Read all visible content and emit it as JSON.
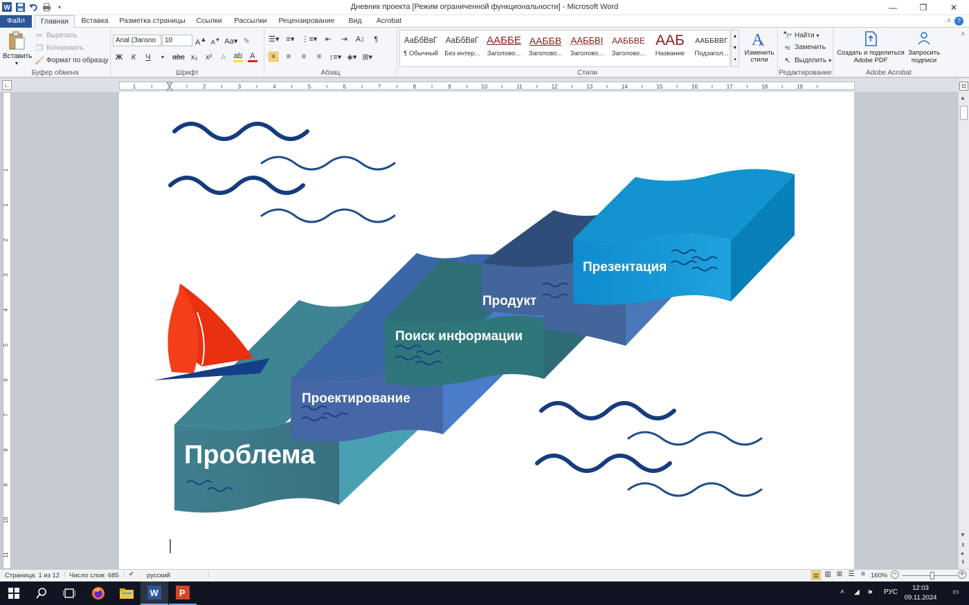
{
  "window": {
    "title": "Дневник проекта [Режим ограниченной функциональности]  -  Microsoft Word",
    "controls": {
      "minimize": "—",
      "restore": "❐",
      "close": "✕"
    }
  },
  "tabs": [
    {
      "label": "Файл"
    },
    {
      "label": "Главная"
    },
    {
      "label": "Вставка"
    },
    {
      "label": "Разметка страницы"
    },
    {
      "label": "Ссылки"
    },
    {
      "label": "Рассылки"
    },
    {
      "label": "Рецензирование"
    },
    {
      "label": "Вид"
    },
    {
      "label": "Acrobat"
    }
  ],
  "ribbon": {
    "clipboard": {
      "paste": "Вставить",
      "cut": "Вырезать",
      "copy": "Копировать",
      "format_painter": "Формат по образцу",
      "label": "Буфер обмена"
    },
    "font": {
      "name": "Arial (Заголо",
      "size": "10",
      "label": "Шрифт"
    },
    "paragraph": {
      "label": "Абзац"
    },
    "styles": {
      "label": "Стили",
      "items": [
        {
          "preview": "АаБбВвГ",
          "name": "¶ Обычный"
        },
        {
          "preview": "АаБбВвГ",
          "name": "Без интер..."
        },
        {
          "preview": "ААББЕ",
          "name": "Заголово..."
        },
        {
          "preview": "ААББВ",
          "name": "Заголово..."
        },
        {
          "preview": "ААББВІ",
          "name": "Заголово..."
        },
        {
          "preview": "ААББВЕ",
          "name": "Заголово..."
        },
        {
          "preview": "ААБ",
          "name": "Название"
        },
        {
          "preview": "ААББВВГ",
          "name": "Подзагол..."
        }
      ],
      "change_styles": "Изменить стили"
    },
    "editing": {
      "find": "Найти",
      "replace": "Заменить",
      "select": "Выделить",
      "label": "Редактирование"
    },
    "acrobat": {
      "create_pdf": "Создать и поделиться Adobe PDF",
      "request_sign": "Запросить подписи",
      "label": "Adobe Acrobat"
    }
  },
  "ruler": {
    "numbers": [
      "1",
      "1",
      "2",
      "3",
      "4",
      "5",
      "6",
      "7",
      "8",
      "9",
      "10",
      "11",
      "12",
      "13",
      "14",
      "15",
      "16",
      "17",
      "18",
      "19"
    ]
  },
  "vruler": {
    "numbers": [
      "1",
      "1",
      "2",
      "3",
      "4",
      "5",
      "6",
      "7",
      "8",
      "9",
      "10",
      "11",
      "12"
    ]
  },
  "document": {
    "stages": [
      "Проблема",
      "Проектирование",
      "Поиск информации",
      "Продукт",
      "Презентация"
    ]
  },
  "status": {
    "page": "Страница: 1 из 12",
    "words": "Число слов: 685",
    "lang": "русский",
    "zoom": "160%"
  },
  "taskbar": {
    "lang": "РУС",
    "time": "12:03",
    "date": "09.11.2024"
  }
}
